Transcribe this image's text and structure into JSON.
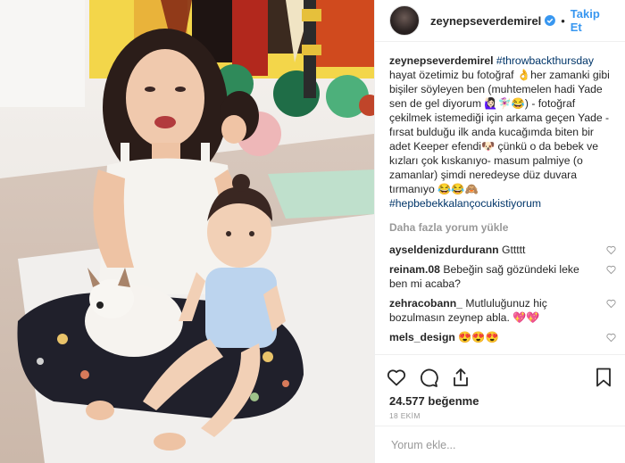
{
  "header": {
    "username": "zeynepseverdemirel",
    "separator": "•",
    "follow_label": "Takip Et"
  },
  "caption": {
    "username": "zeynepseverdemirel",
    "hashtag_top": "#throwbackthursday",
    "text": "hayat özetimiz bu fotoğraf 👌her zamanki gibi bişiler söyleyen ben (muhtemelen hadi Yade sen de gel diyorum 🙋🏻‍♀️🧚🏻‍♀️😂) - fotoğraf çekilmek istemediği için arkama geçen Yade - fırsat bulduğu ilk anda kucağımda biten bir adet Keeper efendi🐶 çünkü o da bebek ve kızları çok kıskanıyo- masum palmiye (o zamanlar) şimdi neredeyse düz duvara tırmanıyo 😂😂🙈",
    "hashtag_bottom": "#hepbebekkalançocukistiyorum"
  },
  "load_more": "Daha fazla yorum yükle",
  "comments": [
    {
      "user": "ayseldenizdurdurann",
      "text": "Gttttt"
    },
    {
      "user": "reinam.08",
      "text": "Bebeğin sağ gözündeki leke ben mi acaba?"
    },
    {
      "user": "zehracobann_",
      "text": "Mutluluğunuz hiç bozulmasın zeynep abla. 💖💖"
    },
    {
      "user": "mels_design",
      "text": "😍😍😍"
    }
  ],
  "likes": "24.577 beğenme",
  "date": "18 EKİM",
  "comment_input": {
    "placeholder": "Yorum ekle..."
  },
  "colors": {
    "accent": "#3897f0",
    "hashtag": "#003569",
    "muted": "#999999",
    "text": "#262626"
  },
  "icons": [
    "heart-icon",
    "comment-icon",
    "share-icon",
    "bookmark-icon",
    "verified-badge-icon"
  ]
}
